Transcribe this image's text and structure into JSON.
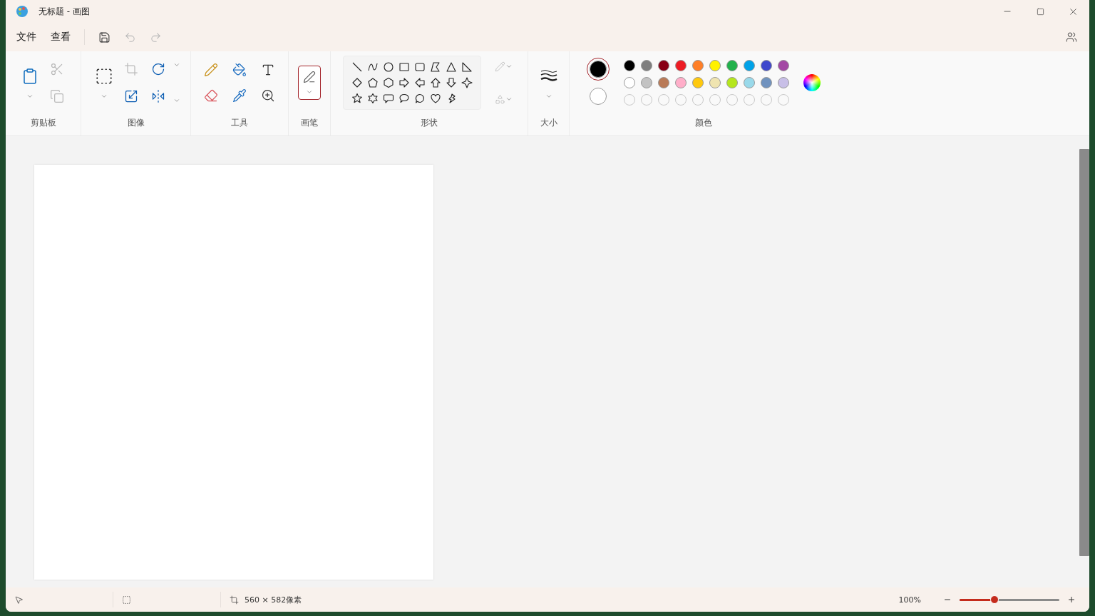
{
  "window": {
    "title": "无标题 - 画图"
  },
  "menu": [
    {
      "label": "文件"
    },
    {
      "label": "查看"
    }
  ],
  "quick_actions": [
    {
      "kind": "save",
      "disabled": false
    },
    {
      "kind": "undo",
      "disabled": true
    },
    {
      "kind": "redo",
      "disabled": true
    }
  ],
  "ribbon": {
    "clipboard": {
      "label": "剪贴板",
      "tools": [
        {
          "kind": "paste",
          "disabled": false
        },
        {
          "kind": "cut",
          "disabled": true
        },
        {
          "kind": "copy",
          "disabled": true
        }
      ]
    },
    "image": {
      "label": "图像",
      "tools": [
        {
          "kind": "select",
          "disabled": false
        },
        {
          "kind": "crop",
          "disabled": true
        },
        {
          "kind": "rotate",
          "disabled": false
        },
        {
          "kind": "resize",
          "disabled": false
        },
        {
          "kind": "flip",
          "disabled": false
        }
      ]
    },
    "tools": {
      "label": "工具",
      "tools": [
        {
          "kind": "pencil",
          "selected": false
        },
        {
          "kind": "fill",
          "selected": false
        },
        {
          "kind": "text",
          "selected": false
        },
        {
          "kind": "eraser",
          "selected": false
        },
        {
          "kind": "picker",
          "selected": false
        },
        {
          "kind": "magnifier",
          "selected": false
        }
      ]
    },
    "brushes": {
      "label": "画笔",
      "selected": true
    },
    "shapes": {
      "label": "形状",
      "outline_disabled": true,
      "fill_disabled": true,
      "items": [
        {
          "kind": "line"
        },
        {
          "kind": "curve"
        },
        {
          "kind": "oval"
        },
        {
          "kind": "rectangle"
        },
        {
          "kind": "rounded-rectangle"
        },
        {
          "kind": "polygon"
        },
        {
          "kind": "triangle"
        },
        {
          "kind": "right-triangle"
        },
        {
          "kind": "diamond"
        },
        {
          "kind": "pentagon"
        },
        {
          "kind": "hexagon"
        },
        {
          "kind": "right-arrow"
        },
        {
          "kind": "left-arrow"
        },
        {
          "kind": "up-arrow"
        },
        {
          "kind": "down-arrow"
        },
        {
          "kind": "four-point-star"
        },
        {
          "kind": "five-point-star"
        },
        {
          "kind": "six-point-star"
        },
        {
          "kind": "rounded-callout"
        },
        {
          "kind": "oval-callout"
        },
        {
          "kind": "cloud-callout"
        },
        {
          "kind": "heart"
        },
        {
          "kind": "lightning"
        }
      ]
    },
    "size": {
      "label": "大小"
    },
    "colors": {
      "label": "颜色",
      "current": [
        {
          "color": "#000000",
          "selected": true
        },
        {
          "color": "#ffffff",
          "selected": false
        }
      ],
      "palette": [
        {
          "color": "#000000"
        },
        {
          "color": "#7f7f7f"
        },
        {
          "color": "#880015"
        },
        {
          "color": "#ed1c24"
        },
        {
          "color": "#ff7f27"
        },
        {
          "color": "#fff200"
        },
        {
          "color": "#22b14c"
        },
        {
          "color": "#00a2e8"
        },
        {
          "color": "#3f48cc"
        },
        {
          "color": "#a349a4"
        },
        {
          "color": "#ffffff"
        },
        {
          "color": "#c3c3c3"
        },
        {
          "color": "#b97a57"
        },
        {
          "color": "#ffaec9"
        },
        {
          "color": "#ffc90e"
        },
        {
          "color": "#efe4b0"
        },
        {
          "color": "#b5e61d"
        },
        {
          "color": "#99d9ea"
        },
        {
          "color": "#7092be"
        },
        {
          "color": "#c8bfe7"
        }
      ]
    }
  },
  "status": {
    "canvas_size": "560 × 582像素",
    "zoom": "100%",
    "level": 0.35
  }
}
